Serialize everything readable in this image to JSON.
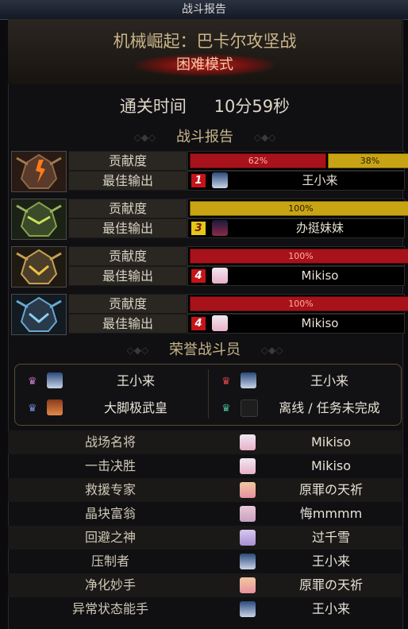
{
  "window": {
    "title": "战斗报告"
  },
  "dungeon": {
    "name": "机械崛起：巴卡尔攻坚战",
    "mode": "困难模式"
  },
  "clear_time": {
    "label": "通关时间",
    "value": "10分59秒"
  },
  "report_section": "战斗报告",
  "bosses": [
    {
      "icon": "red-dragon-boss-icon",
      "contribution_label": "贡献度",
      "best_dps_label": "最佳输出",
      "contribution": [
        {
          "percent": 62,
          "label": "62%",
          "color": "#a8121a"
        },
        {
          "percent": 38,
          "label": "38%",
          "color": "#c8a414"
        }
      ],
      "best_rank": "1",
      "best_player": "王小来"
    },
    {
      "icon": "green-dragon-boss-icon",
      "contribution_label": "贡献度",
      "best_dps_label": "最佳输出",
      "contribution": [
        {
          "percent": 100,
          "label": "100%",
          "color": "#c8a414"
        }
      ],
      "best_rank": "3",
      "best_player": "办挺妹妹"
    },
    {
      "icon": "gold-dragon-boss-icon",
      "contribution_label": "贡献度",
      "best_dps_label": "最佳输出",
      "contribution": [
        {
          "percent": 100,
          "label": "100%",
          "color": "#a8121a"
        }
      ],
      "best_rank": "4",
      "best_player": "Mikiso"
    },
    {
      "icon": "blue-dragon-boss-icon",
      "contribution_label": "贡献度",
      "best_dps_label": "最佳输出",
      "contribution": [
        {
          "percent": 100,
          "label": "100%",
          "color": "#a8121a"
        }
      ],
      "best_rank": "4",
      "best_player": "Mikiso"
    }
  ],
  "honor_section": "荣誉战斗员",
  "honor_members": [
    "王小来",
    "王小来",
    "大脚极武皇",
    "离线 / 任务未完成"
  ],
  "awards": [
    {
      "title": "战场名将",
      "player": "Mikiso"
    },
    {
      "title": "一击决胜",
      "player": "Mikiso"
    },
    {
      "title": "救援专家",
      "player": "原罪の天祈"
    },
    {
      "title": "晶块富翁",
      "player": "悔mmmm"
    },
    {
      "title": "回避之神",
      "player": "过千雪"
    },
    {
      "title": "压制者",
      "player": "王小来"
    },
    {
      "title": "净化妙手",
      "player": "原罪の天祈"
    },
    {
      "title": "异常状态能手",
      "player": "王小来"
    }
  ],
  "colors": {
    "accent_gold": "#c9b68a",
    "contribution_red": "#a8121a",
    "contribution_yellow": "#c8a414"
  }
}
